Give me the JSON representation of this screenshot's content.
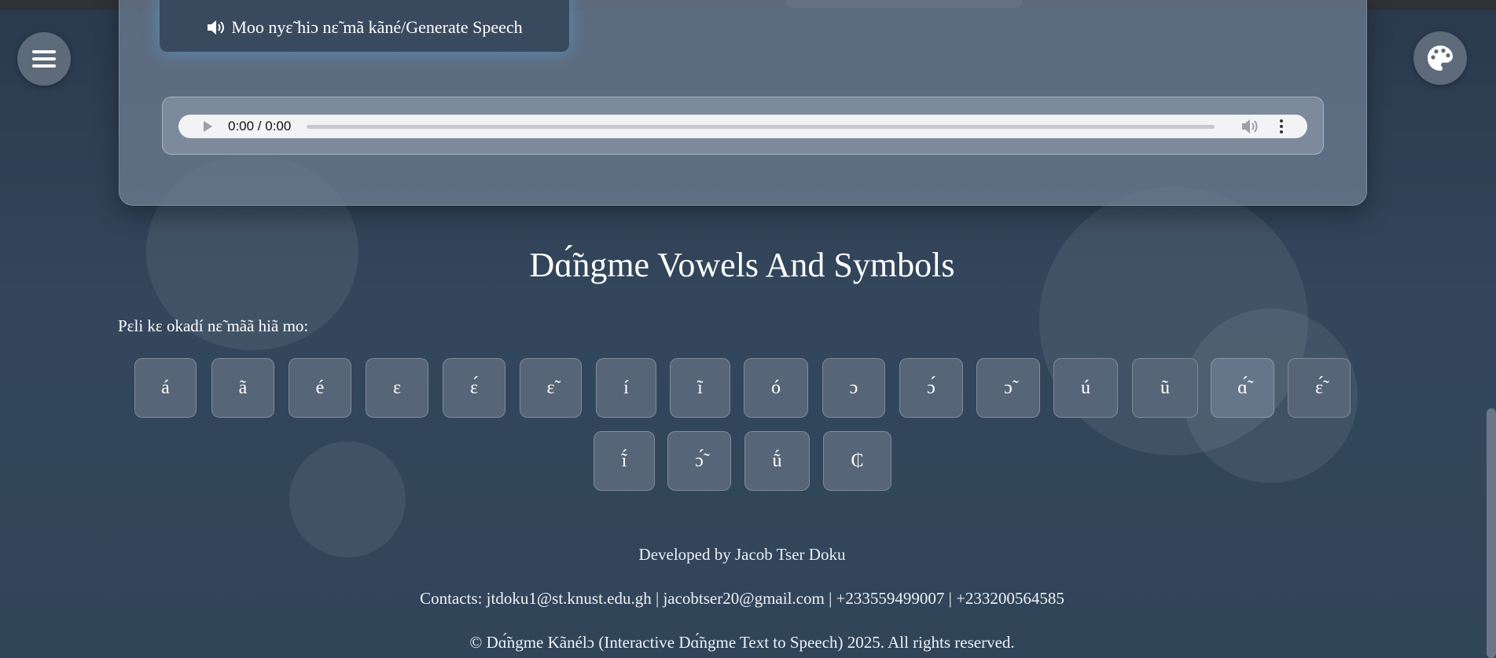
{
  "generate_button": {
    "label": "Moo nyɛ̃ hiɔ nɛ̃ mã kãné/Generate Speech"
  },
  "audio": {
    "time": "0:00 / 0:00"
  },
  "section": {
    "title": "Dɑ̃́ngme Vowels And Symbols",
    "prompt": "Pɛli kɛ okadí nɛ̃ mãã hiã mo:"
  },
  "symbols": [
    "á",
    "ã",
    "é",
    "ɛ",
    "ɛ́",
    "ɛ̃",
    "í",
    "ĩ",
    "ó",
    "ɔ",
    "ɔ́",
    "ɔ̃",
    "ú",
    "ũ",
    "ɑ̃́",
    "ɛ̃́",
    "ĩ́",
    "ɔ̃́",
    "ṹ",
    "₵"
  ],
  "footer": {
    "developed": "Developed by Jacob Tser Doku",
    "contacts": "Contacts: jtdoku1@st.knust.edu.gh | jacobtser20@gmail.com | +233559499007 | +233200564585",
    "copyright": "© Dɑ̃́ngme Kãnélɔ (Interactive Dɑ̃́ngme Text to Speech) 2025. All rights reserved."
  }
}
